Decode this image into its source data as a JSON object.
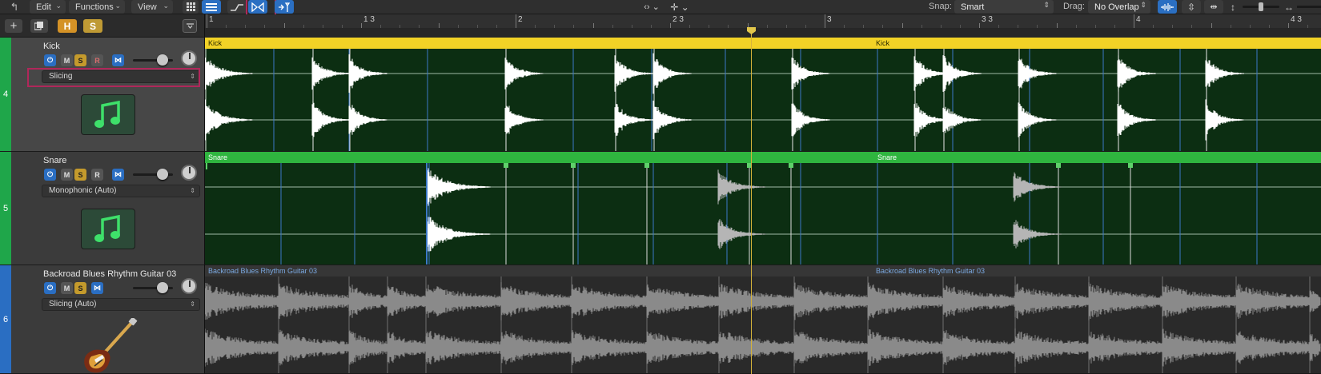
{
  "toolbar": {
    "edit": "Edit",
    "functions": "Functions",
    "view": "View",
    "snap_label": "Snap:",
    "snap_value": "Smart",
    "drag_label": "Drag:",
    "drag_value": "No Overlap"
  },
  "header": {
    "h_label": "H",
    "s_label": "S"
  },
  "ruler": {
    "labels": [
      "1",
      "1 3",
      "2",
      "2 3",
      "3",
      "3 3",
      "4",
      "4 3"
    ]
  },
  "tracks": [
    {
      "number": "4",
      "name": "Kick",
      "flex_mode": "Slicing",
      "mute": "M",
      "solo": "S",
      "record": "R",
      "region_name": "Kick",
      "region_name_2": "Kick",
      "colors": {
        "strip": "#1fa64a",
        "region_header": "#f2d226",
        "region_body": "#0c2e12",
        "wave": "#ffffff"
      }
    },
    {
      "number": "5",
      "name": "Snare",
      "flex_mode": "Monophonic (Auto)",
      "mute": "M",
      "solo": "S",
      "record": "R",
      "region_name": "Snare",
      "region_name_2": "Snare",
      "colors": {
        "strip": "#1fa64a",
        "region_header": "#2fb53f",
        "region_body": "#0c2e12",
        "wave": "#ffffff"
      }
    },
    {
      "number": "6",
      "name": "Backroad Blues Rhythm Guitar 03",
      "flex_mode": "Slicing (Auto)",
      "mute": "M",
      "solo": "S",
      "region_name": "Backroad Blues Rhythm Guitar 03",
      "region_name_2": "Backroad Blues Rhythm Guitar 03",
      "colors": {
        "strip": "#2a6ec2",
        "region_header": "#3a3a3a",
        "region_body": "#2a2a2a",
        "wave": "#9a9a9a"
      }
    }
  ],
  "icons": {
    "undo": "undo-arrow-icon",
    "grid": "grid-view-icon",
    "list": "list-view-icon",
    "automation": "automation-icon",
    "flex": "flex-time-icon",
    "catch": "catch-playhead-icon",
    "add": "add-track-icon",
    "dup": "duplicate-track-icon",
    "power": "power-icon",
    "music": "music-note-icon",
    "guitar": "electric-guitar-icon"
  },
  "accent": "#2b6fc2",
  "highlight": "#b0275a"
}
